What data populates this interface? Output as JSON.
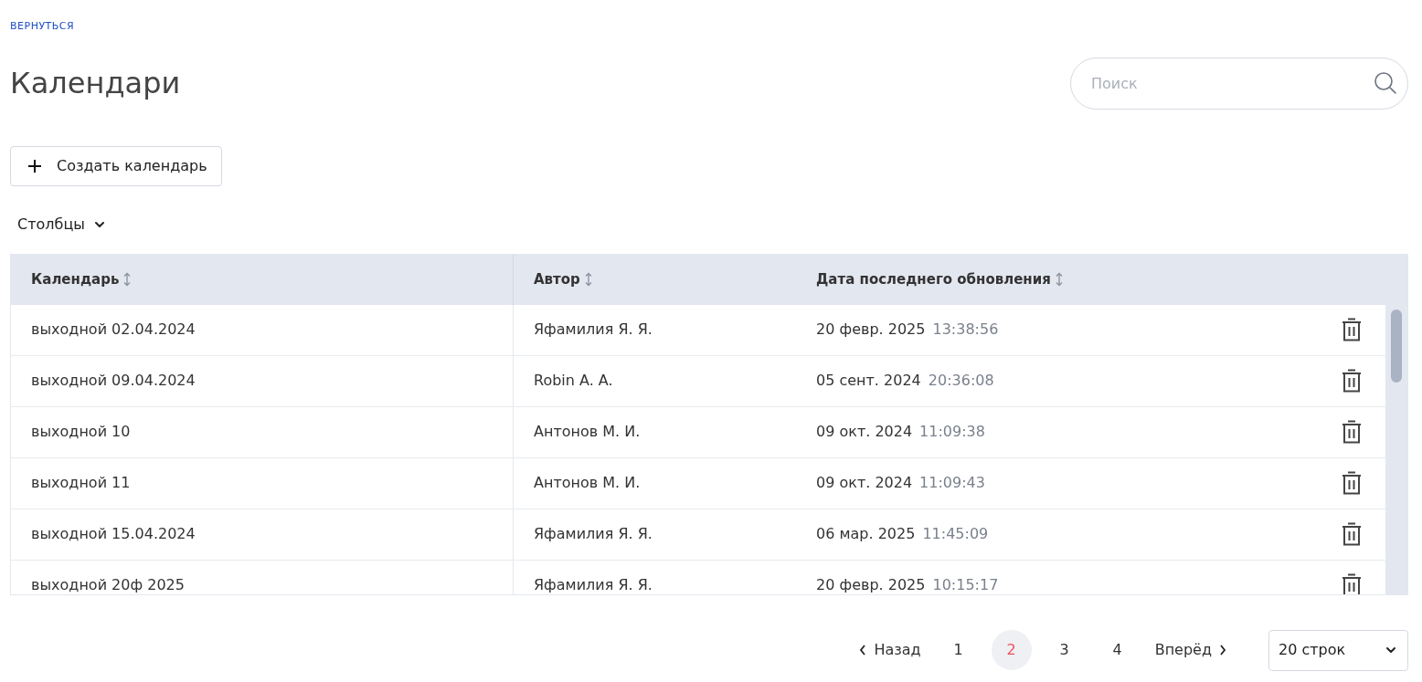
{
  "back_link": "ВЕРНУТЬСЯ",
  "title": "Календари",
  "search": {
    "placeholder": "Поиск"
  },
  "create_button": "Создать календарь",
  "columns_menu": "Столбцы",
  "table": {
    "columns": [
      "Календарь",
      "Автор",
      "Дата последнего обновления"
    ],
    "rows": [
      {
        "name": "выходной 02.04.2024",
        "author": "Яфамилия Я. Я.",
        "date": "20 февр. 2025",
        "time": "13:38:56"
      },
      {
        "name": "выходной 09.04.2024",
        "author": "Robin A. A.",
        "date": "05 сент. 2024",
        "time": "20:36:08"
      },
      {
        "name": "выходной 10",
        "author": "Антонов М. И.",
        "date": "09 окт. 2024",
        "time": "11:09:38"
      },
      {
        "name": "выходной 11",
        "author": "Антонов М. И.",
        "date": "09 окт. 2024",
        "time": "11:09:43"
      },
      {
        "name": "выходной 15.04.2024",
        "author": "Яфамилия Я. Я.",
        "date": "06 мар. 2025",
        "time": "11:45:09"
      },
      {
        "name": "выходной 20ф 2025",
        "author": "Яфамилия Я. Я.",
        "date": "20 февр. 2025",
        "time": "10:15:17"
      }
    ]
  },
  "pagination": {
    "prev": "Назад",
    "next": "Вперёд",
    "pages": [
      {
        "label": "1",
        "selected": false
      },
      {
        "label": "2",
        "selected": true
      },
      {
        "label": "3",
        "selected": false
      },
      {
        "label": "4",
        "selected": false
      }
    ],
    "page_size": "20 строк"
  }
}
